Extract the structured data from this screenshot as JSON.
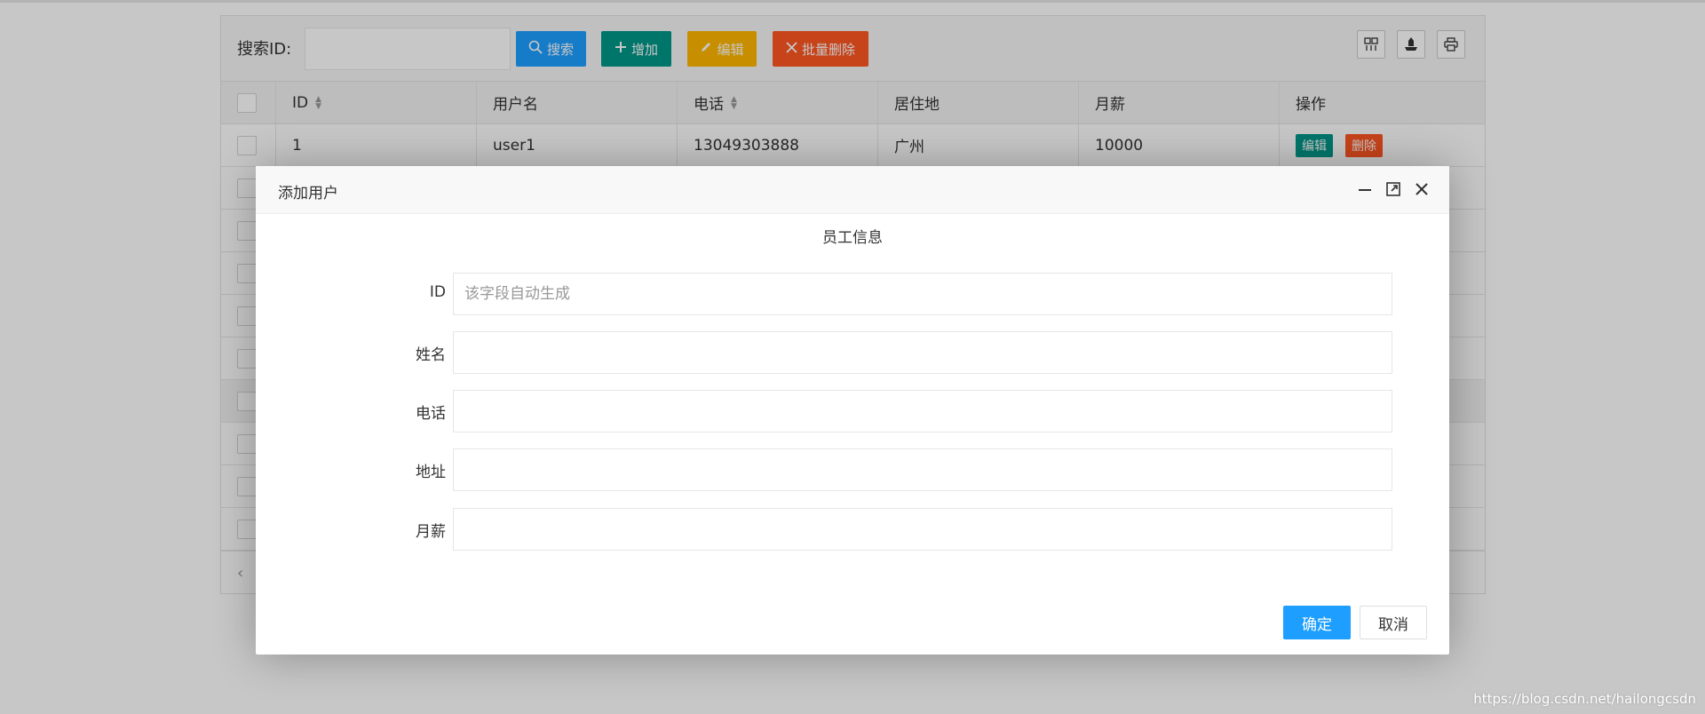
{
  "toolbar": {
    "search_label": "搜索ID:",
    "search_value": "",
    "buttons": {
      "search": "搜索",
      "add": "增加",
      "edit": "编辑",
      "batch_delete": "批量删除"
    },
    "icons": [
      "columns-icon",
      "export-icon",
      "print-icon"
    ]
  },
  "table": {
    "columns": [
      "ID",
      "用户名",
      "电话",
      "居住地",
      "月薪",
      "操作"
    ],
    "rows": [
      {
        "id": "1",
        "username": "user1",
        "phone": "13049303888",
        "city": "广州",
        "salary": "10000",
        "edit": "编辑",
        "delete": "删除"
      }
    ]
  },
  "dialog": {
    "title": "添加用户",
    "legend": "员工信息",
    "fields": [
      {
        "label": "ID",
        "placeholder": "该字段自动生成",
        "value": ""
      },
      {
        "label": "姓名",
        "placeholder": "",
        "value": ""
      },
      {
        "label": "电话",
        "placeholder": "",
        "value": ""
      },
      {
        "label": "地址",
        "placeholder": "",
        "value": ""
      },
      {
        "label": "月薪",
        "placeholder": "",
        "value": ""
      }
    ],
    "confirm": "确定",
    "cancel": "取消"
  },
  "watermark": "https://blog.csdn.net/hailongcsdn",
  "colors": {
    "primary": "#1e9fff",
    "add": "#009688",
    "edit": "#ffb800",
    "delete": "#ff5722"
  }
}
